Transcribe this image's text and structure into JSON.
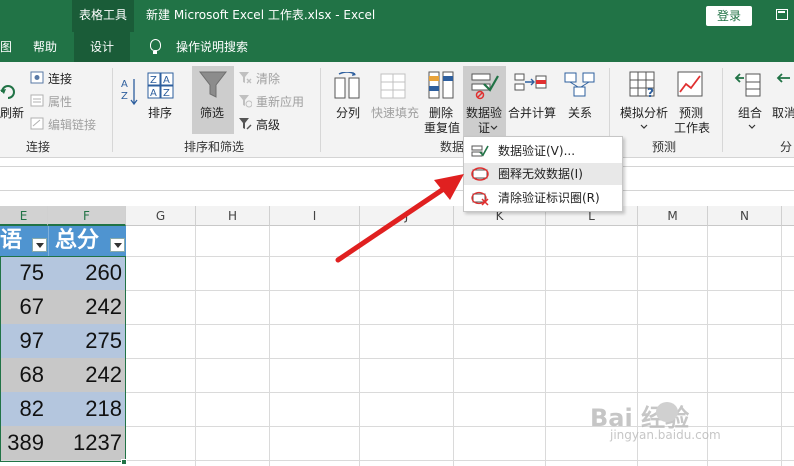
{
  "titlebar": {
    "context_tab": "表格工具",
    "document_title": "新建 Microsoft Excel 工作表.xlsx  -  Excel",
    "login_button": "登录"
  },
  "tabs": {
    "partial_left": "图",
    "help": "帮助",
    "design": "设计",
    "tell_me": "操作说明搜索"
  },
  "ribbon": {
    "connections": {
      "refresh_partial": "刷新",
      "connections": "连接",
      "properties": "属性",
      "edit_links": "编辑链接",
      "group_label": "连接"
    },
    "sort_filter": {
      "sort": "排序",
      "filter": "筛选",
      "clear": "清除",
      "reapply": "重新应用",
      "advanced": "高级",
      "group_label": "排序和筛选"
    },
    "data_tools": {
      "text_to_columns": "分列",
      "flash_fill": "快速填充",
      "remove_duplicates_l1": "删除",
      "remove_duplicates_l2": "重复值",
      "data_validation_l1": "数据验",
      "data_validation_l2": "证",
      "consolidate": "合并计算",
      "relationships": "关系",
      "group_label_partial": "数据"
    },
    "forecast": {
      "what_if_l1": "模拟分析",
      "forecast_sheet_l1": "预测",
      "forecast_sheet_l2": "工作表",
      "group_label": "预测"
    },
    "outline": {
      "group": "组合",
      "ungroup_partial": "取消",
      "group_label_partial": "分"
    }
  },
  "dropdown": {
    "items": [
      "数据验证(V)...",
      "圈释无效数据(I)",
      "清除验证标识圈(R)"
    ]
  },
  "columns": [
    "E",
    "F",
    "G",
    "H",
    "I",
    "J",
    "K",
    "L",
    "M",
    "N"
  ],
  "table": {
    "headers": [
      "语",
      "总分"
    ],
    "rows": [
      [
        "75",
        "260"
      ],
      [
        "67",
        "242"
      ],
      [
        "97",
        "275"
      ],
      [
        "68",
        "242"
      ],
      [
        "82",
        "218"
      ],
      [
        "389",
        "1237"
      ]
    ]
  },
  "watermark": {
    "brand": "Bai 经验",
    "url": "jingyan.baidu.com"
  },
  "colors": {
    "excel_green": "#217346",
    "table_header_blue": "#4f94d0",
    "cell_band_blue": "#b4c6de",
    "cell_band_gray": "#c8c8c8",
    "arrow_red": "#e02020"
  }
}
